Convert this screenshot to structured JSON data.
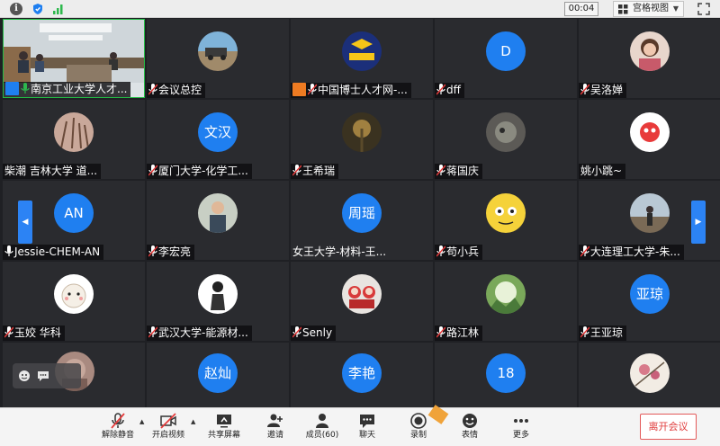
{
  "topbar": {
    "timer": "00:04",
    "view_mode": "宫格视图",
    "colors": {
      "shield": "#1f7ff0",
      "signal": "#2db84d"
    }
  },
  "tiles": [
    {
      "name": "南京工业大学人才...",
      "avatar_text": ""
    },
    {
      "name": "会议总控",
      "avatar_text": ""
    },
    {
      "name": "中国博士人才网-...",
      "avatar_text": ""
    },
    {
      "name": "dff",
      "avatar_text": "D"
    },
    {
      "name": "吴洛婵",
      "avatar_text": ""
    },
    {
      "name": "柴潮 吉林大学 道...",
      "avatar_text": ""
    },
    {
      "name": "厦门大学-化学工...",
      "avatar_text": "文汉"
    },
    {
      "name": "王希瑞",
      "avatar_text": ""
    },
    {
      "name": "蒋国庆",
      "avatar_text": ""
    },
    {
      "name": "姚小跳~",
      "avatar_text": ""
    },
    {
      "name": "Jessie-CHEM-AN",
      "avatar_text": "AN"
    },
    {
      "name": "李宏亮",
      "avatar_text": ""
    },
    {
      "name": "女王大学-材料-王...",
      "avatar_text": "周瑶"
    },
    {
      "name": "苟小兵",
      "avatar_text": ""
    },
    {
      "name": "大连理工大学-朱...",
      "avatar_text": ""
    },
    {
      "name": "玉姣 华科",
      "avatar_text": ""
    },
    {
      "name": "武汉大学-能源材...",
      "avatar_text": ""
    },
    {
      "name": "Senly",
      "avatar_text": ""
    },
    {
      "name": "路江林",
      "avatar_text": ""
    },
    {
      "name": "王亚琼",
      "avatar_text": "亚琼"
    },
    {
      "name": "",
      "avatar_text": ""
    },
    {
      "name": "",
      "avatar_text": "赵灿"
    },
    {
      "name": "",
      "avatar_text": "李艳"
    },
    {
      "name": "",
      "avatar_text": "18"
    },
    {
      "name": "",
      "avatar_text": ""
    }
  ],
  "toolbar": {
    "unmute": "解除静音",
    "start_video": "开启视频",
    "share_screen": "共享屏幕",
    "invite": "邀请",
    "members": "成员(60)",
    "chat": "聊天",
    "record": "录制",
    "reactions": "表情",
    "more": "更多",
    "leave": "离开会议"
  },
  "colors": {
    "accent": "#1f7ff0",
    "leave": "#e03c3c",
    "active_border": "#22bb44"
  }
}
